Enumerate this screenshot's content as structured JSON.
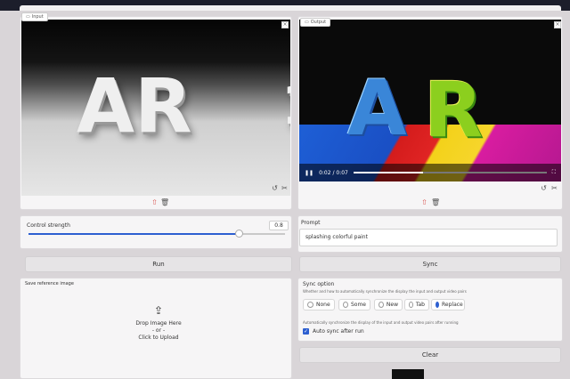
{
  "input": {
    "label": "Input",
    "image_text": "AR",
    "image_text_partial": "1"
  },
  "output": {
    "label": "Output",
    "video_text_a": "A",
    "video_text_r": "R",
    "time": "0:02 / 0:07",
    "progress": 0.36
  },
  "control": {
    "label": "Control strength",
    "value": "0.8",
    "fill": 0.82
  },
  "prompt": {
    "label": "Prompt",
    "value": "splashing colorful paint"
  },
  "buttons": {
    "run": "Run",
    "sync": "Sync",
    "clear": "Clear"
  },
  "reference": {
    "label": "Save reference image",
    "drop_line1": "Drop Image Here",
    "drop_line2": "- or -",
    "drop_line3": "Click to Upload"
  },
  "sync_option": {
    "title": "Sync option",
    "description": "Whether and how to automatically synchronize the display the input and output video pairs",
    "options": [
      "None",
      "Some",
      "New",
      "Tab",
      "Replace"
    ],
    "selected": "Replace",
    "auto_description": "Automatically synchronize the display of the input and output video pairs after running",
    "auto_label": "Auto sync after run",
    "auto_checked": true
  },
  "colors": {
    "accent": "#2d5fd0",
    "upload_icon": "#d9534f"
  }
}
